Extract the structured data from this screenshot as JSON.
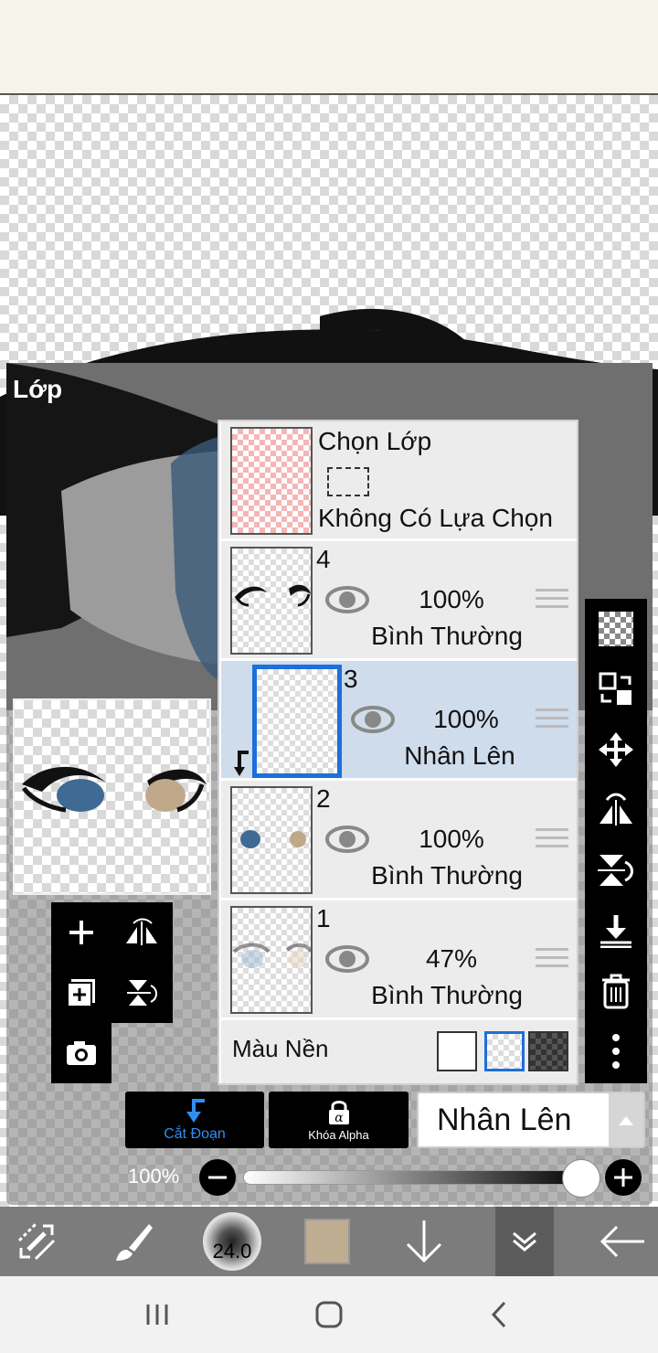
{
  "panel": {
    "title": "Lớp"
  },
  "selection_row": {
    "title": "Chọn Lớp",
    "status": "Không Có Lựa Chọn"
  },
  "layers": [
    {
      "number": "4",
      "opacity": "100%",
      "blend": "Bình Thường"
    },
    {
      "number": "3",
      "opacity": "100%",
      "blend": "Nhân Lên"
    },
    {
      "number": "2",
      "opacity": "100%",
      "blend": "Bình Thường"
    },
    {
      "number": "1",
      "opacity": "47%",
      "blend": "Bình Thường"
    }
  ],
  "background_row": {
    "label": "Màu Nền"
  },
  "actions": {
    "clip_label": "Cắt Đoạn",
    "alpha_lock_label": "Khóa Alpha"
  },
  "blend_mode": {
    "selected": "Nhân Lên"
  },
  "layer_opacity": {
    "label": "100%",
    "value": 100
  },
  "brush": {
    "size": "24.0"
  },
  "colors": {
    "current": "#bfad91",
    "eye_blue": "#3f6a93",
    "eye_tan": "#bfa98a",
    "accent": "#1e6fd9"
  },
  "icons": {
    "layer_tools": [
      "plus-icon",
      "flip-horizontal-icon",
      "add-layer-icon",
      "flip-vertical-icon",
      "camera-icon"
    ],
    "right_tools": [
      "transparency-icon",
      "swap-layers-icon",
      "move-icon",
      "flip-horizontal-icon",
      "flip-vertical-icon",
      "merge-down-icon",
      "trash-icon",
      "more-icon"
    ],
    "bottom_toolbar": [
      "transform-icon",
      "brush-icon",
      "brush-size-icon",
      "color-icon",
      "arrow-down-icon",
      "layers-toggle-icon",
      "back-arrow-icon"
    ],
    "nav": [
      "recent-apps-icon",
      "home-icon",
      "back-icon"
    ]
  }
}
